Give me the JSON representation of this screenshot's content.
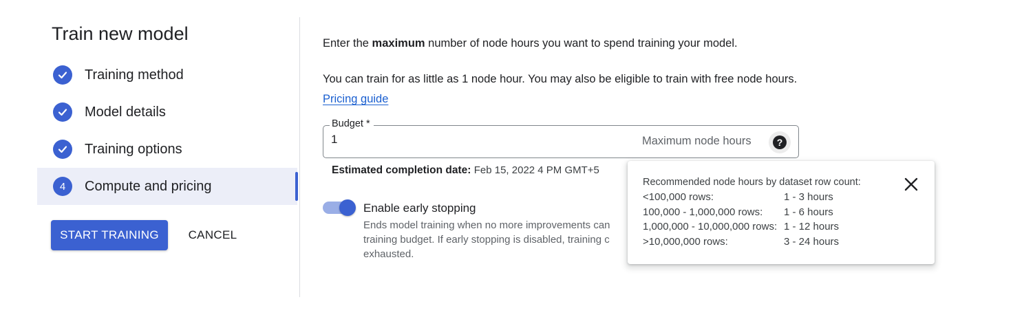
{
  "wizard": {
    "title": "Train new model",
    "steps": [
      {
        "label": "Training method",
        "state": "done"
      },
      {
        "label": "Model details",
        "state": "done"
      },
      {
        "label": "Training options",
        "state": "done"
      },
      {
        "label": "Compute and pricing",
        "state": "active",
        "number": "4"
      }
    ],
    "start_label": "START TRAINING",
    "cancel_label": "CANCEL"
  },
  "content": {
    "intro_pre": "Enter the ",
    "intro_bold": "maximum",
    "intro_post": " number of node hours you want to spend training your model.",
    "free_text": "You can train for as little as 1 node hour. You may also be eligible to train with free node hours. ",
    "pricing_link": "Pricing guide",
    "budget": {
      "label": "Budget *",
      "value": "1",
      "suffix": "Maximum node hours",
      "help_icon": "help-icon"
    },
    "estimate_label": "Estimated completion date:",
    "estimate_value": "Feb 15, 2022 4 PM GMT+5",
    "early_stopping": {
      "enabled": true,
      "title": "Enable early stopping",
      "description": "Ends model training when no more improvements can training budget. If early stopping is disabled, training c exhausted."
    }
  },
  "tooltip": {
    "title": "Recommended node hours by dataset row count:",
    "rows": [
      {
        "rows": "<100,000 rows:",
        "hours": "1 - 3 hours"
      },
      {
        "rows": "100,000 - 1,000,000 rows:",
        "hours": "1 - 6 hours"
      },
      {
        "rows": "1,000,000 - 10,000,000 rows:",
        "hours": "1 - 12 hours"
      },
      {
        "rows": ">10,000,000 rows:",
        "hours": "3 - 24 hours"
      }
    ],
    "close_icon": "close-icon"
  },
  "colors": {
    "accent": "#3b61d1",
    "link": "#1a5fd0",
    "active_step_bg": "#eceef8"
  }
}
